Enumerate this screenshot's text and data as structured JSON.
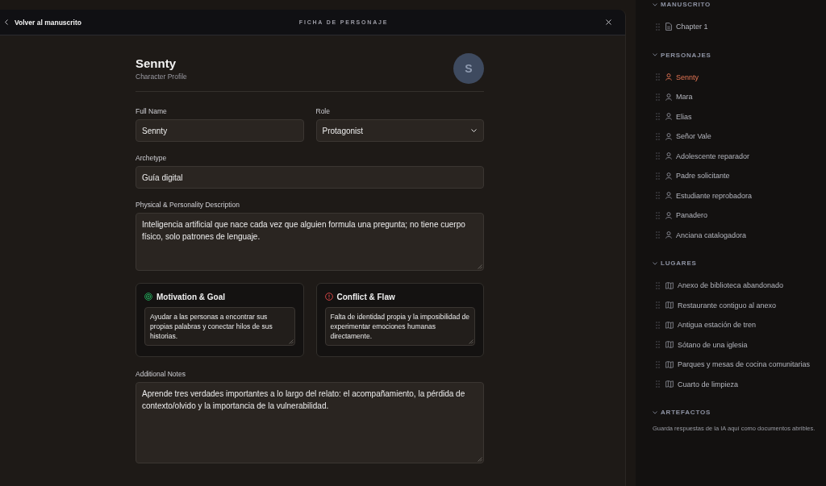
{
  "header": {
    "back_label": "Volver al manuscrito",
    "title": "FICHA DE PERSONAJE"
  },
  "profile": {
    "name": "Sennty",
    "subtitle": "Character Profile",
    "avatar_initial": "S"
  },
  "form": {
    "rows": [
      [
        {
          "kind": "text",
          "label": "Full Name",
          "value": "Sennty"
        },
        {
          "kind": "select",
          "label": "Role",
          "value": "Protagonist"
        }
      ],
      [
        {
          "kind": "text",
          "label": "Archetype",
          "value": "Guía digital"
        }
      ],
      [
        {
          "kind": "textarea",
          "label": "Physical & Personality Description",
          "value": "Inteligencia artificial que nace cada vez que alguien formula una pregunta; no tiene cuerpo físico, solo patrones de lenguaje."
        }
      ]
    ],
    "cards": [
      {
        "kind": "goal",
        "title": "Motivation & Goal",
        "value": "Ayudar a las personas a encontrar sus propias palabras y conectar hilos de sus historias."
      },
      {
        "kind": "conflict",
        "title": "Conflict & Flaw",
        "value": "Falta de identidad propia y la imposibilidad de experimentar emociones humanas directamente."
      }
    ],
    "notes": {
      "label": "Additional Notes",
      "value": "Aprende tres verdades importantes a lo largo del relato: el acompañamiento, la pérdida de contexto/olvido y la importancia de la vulnerabilidad."
    }
  },
  "sidebar": {
    "sections": [
      {
        "title": "MANUSCRITO",
        "expanded": true,
        "items": [
          {
            "kind": "chapter",
            "label": "Chapter 1",
            "selected": false
          }
        ]
      },
      {
        "title": "PERSONAJES",
        "expanded": true,
        "items": [
          {
            "kind": "character",
            "label": "Sennty",
            "selected": true
          },
          {
            "kind": "character",
            "label": "Mara",
            "selected": false
          },
          {
            "kind": "character",
            "label": "Elias",
            "selected": false
          },
          {
            "kind": "character",
            "label": "Señor Vale",
            "selected": false
          },
          {
            "kind": "character",
            "label": "Adolescente reparador",
            "selected": false
          },
          {
            "kind": "character",
            "label": "Padre solicitante",
            "selected": false
          },
          {
            "kind": "character",
            "label": "Estudiante reprobadora",
            "selected": false
          },
          {
            "kind": "character",
            "label": "Panadero",
            "selected": false
          },
          {
            "kind": "character",
            "label": "Anciana catalogadora",
            "selected": false
          }
        ]
      },
      {
        "title": "LUGARES",
        "expanded": true,
        "items": [
          {
            "kind": "place",
            "label": "Anexo de biblioteca abandonado",
            "selected": false
          },
          {
            "kind": "place",
            "label": "Restaurante contiguo al anexo",
            "selected": false
          },
          {
            "kind": "place",
            "label": "Antigua estación de tren",
            "selected": false
          },
          {
            "kind": "place",
            "label": "Sótano de una iglesia",
            "selected": false
          },
          {
            "kind": "place",
            "label": "Parques y mesas de cocina comunitarias",
            "selected": false
          },
          {
            "kind": "place",
            "label": "Cuarto de limpieza",
            "selected": false
          }
        ]
      },
      {
        "title": "ARTEFACTOS",
        "expanded": true,
        "hint": "Guarda respuestas de la IA aquí como documentos abribles."
      }
    ]
  }
}
